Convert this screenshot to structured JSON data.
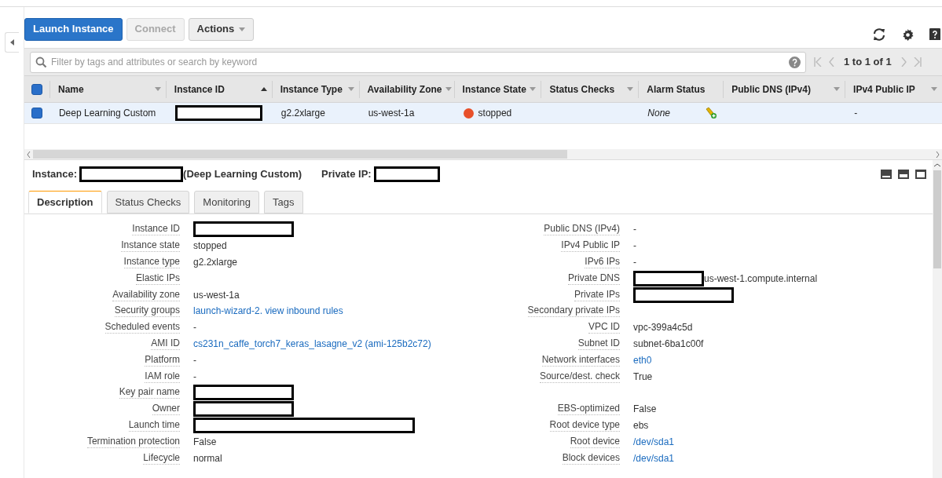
{
  "toolbar": {
    "buttons": [
      {
        "label": "Launch Instance",
        "kind": "primary",
        "disabled": false
      },
      {
        "label": "Connect",
        "kind": "plain",
        "disabled": true
      },
      {
        "label": "Actions",
        "kind": "dropdown",
        "disabled": false
      }
    ]
  },
  "filter": {
    "placeholder": "Filter by tags and attributes or search by keyword"
  },
  "pagination": {
    "text": "1 to 1 of 1"
  },
  "table": {
    "select_all": {
      "checked": true
    },
    "columns": [
      {
        "label": "Name",
        "sorted": false,
        "menu": true
      },
      {
        "label": "Instance ID",
        "sorted": true,
        "menu": false
      },
      {
        "label": "Instance Type",
        "sorted": false,
        "menu": true
      },
      {
        "label": "Availability Zone",
        "sorted": false,
        "menu": true
      },
      {
        "label": "Instance State",
        "sorted": false,
        "menu": true
      },
      {
        "label": "Status Checks",
        "sorted": false,
        "menu": true
      },
      {
        "label": "Alarm Status",
        "sorted": false,
        "menu": false
      },
      {
        "label": "Public DNS (IPv4)",
        "sorted": false,
        "menu": true
      },
      {
        "label": "IPv4 Public IP",
        "sorted": false,
        "menu": true
      }
    ],
    "rows": [
      {
        "selected": true,
        "cells": [
          {
            "kind": "text",
            "text": "Deep Learning Custom"
          },
          {
            "kind": "redacted"
          },
          {
            "kind": "text",
            "text": "g2.2xlarge"
          },
          {
            "kind": "text",
            "text": "us-west-1a"
          },
          {
            "kind": "state",
            "text": "stopped",
            "color": "#e8502a"
          },
          {
            "kind": "empty"
          },
          {
            "kind": "alarm",
            "text": "None"
          },
          {
            "kind": "empty"
          },
          {
            "kind": "text",
            "text": "-"
          }
        ]
      }
    ]
  },
  "details": {
    "instance_label": "Instance:",
    "instance_name": "(Deep Learning Custom)",
    "private_ip_label": "Private IP:",
    "tabs": [
      {
        "label": "Description",
        "selected": true
      },
      {
        "label": "Status Checks",
        "selected": false
      },
      {
        "label": "Monitoring",
        "selected": false
      },
      {
        "label": "Tags",
        "selected": false
      }
    ],
    "left": [
      {
        "label": "Instance ID",
        "kind": "redacted"
      },
      {
        "label": "Instance state",
        "kind": "text",
        "value": "stopped"
      },
      {
        "label": "Instance type",
        "kind": "text",
        "value": "g2.2xlarge"
      },
      {
        "label": "Elastic IPs",
        "kind": "empty"
      },
      {
        "label": "Availability zone",
        "kind": "text",
        "value": "us-west-1a"
      },
      {
        "label": "Security groups",
        "kind": "links",
        "links": [
          "launch-wizard-2",
          ". ",
          "view inbound rules"
        ]
      },
      {
        "label": "Scheduled events",
        "kind": "text",
        "value": "-"
      },
      {
        "label": "AMI ID",
        "kind": "link",
        "value": "cs231n_caffe_torch7_keras_lasagne_v2 (ami-125b2c72)"
      },
      {
        "label": "Platform",
        "kind": "text",
        "value": "-"
      },
      {
        "label": "IAM role",
        "kind": "text",
        "value": "-"
      },
      {
        "label": "Key pair name",
        "kind": "redacted"
      },
      {
        "label": "Owner",
        "kind": "redacted"
      },
      {
        "label": "Launch time",
        "kind": "longredacted"
      },
      {
        "label": "Termination protection",
        "kind": "text",
        "value": "False"
      },
      {
        "label": "Lifecycle",
        "kind": "text",
        "value": "normal"
      }
    ],
    "right_groups": [
      [
        {
          "label": "Public DNS (IPv4)",
          "kind": "text",
          "value": "-"
        },
        {
          "label": "IPv4 Public IP",
          "kind": "text",
          "value": "-"
        },
        {
          "label": "IPv6 IPs",
          "kind": "text",
          "value": "-"
        },
        {
          "label": "Private DNS",
          "kind": "redactedsuffix",
          "value": "us-west-1.compute.internal"
        },
        {
          "label": "Private IPs",
          "kind": "redacted"
        },
        {
          "label": "Secondary private IPs",
          "kind": "empty"
        },
        {
          "label": "VPC ID",
          "kind": "text",
          "value": "vpc-399a4c5d"
        },
        {
          "label": "Subnet ID",
          "kind": "text",
          "value": "subnet-6ba1c00f"
        },
        {
          "label": "Network interfaces",
          "kind": "link",
          "value": "eth0"
        },
        {
          "label": "Source/dest. check",
          "kind": "text",
          "value": "True"
        }
      ],
      [
        {
          "label": "EBS-optimized",
          "kind": "text",
          "value": "False"
        },
        {
          "label": "Root device type",
          "kind": "text",
          "value": "ebs"
        },
        {
          "label": "Root device",
          "kind": "link",
          "value": "/dev/sda1"
        },
        {
          "label": "Block devices",
          "kind": "link",
          "value": "/dev/sda1"
        }
      ]
    ]
  }
}
